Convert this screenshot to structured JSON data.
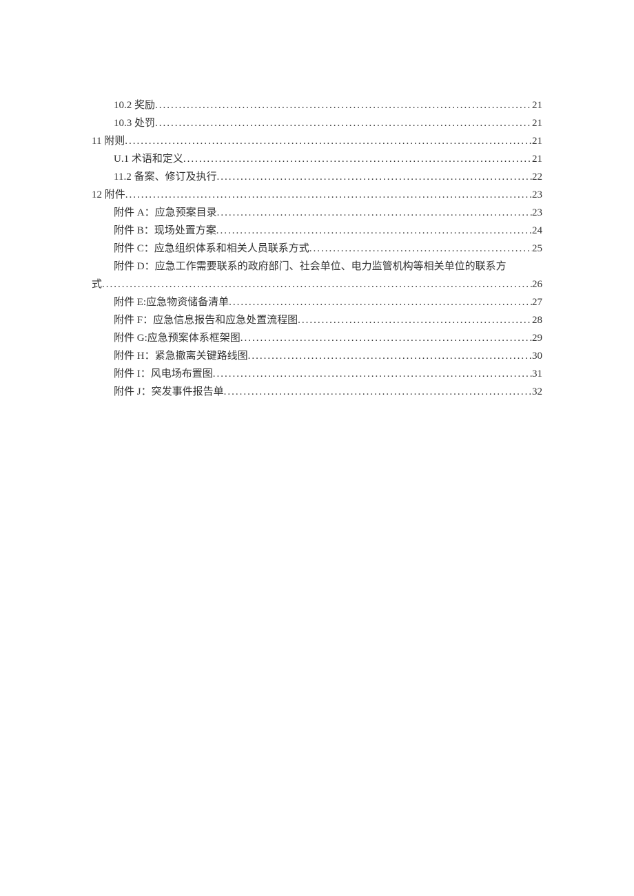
{
  "toc": {
    "items": [
      {
        "label": "10.2 奖励",
        "page": "21",
        "indent": 1
      },
      {
        "label": "10.3 处罚",
        "page": "21",
        "indent": 1
      },
      {
        "label": "11 附则",
        "page": "21",
        "indent": 0
      },
      {
        "label": "U.1 术语和定义",
        "page": "21",
        "indent": 1
      },
      {
        "label": "11.2 备案、修订及执行",
        "page": "22",
        "indent": 1
      },
      {
        "label": "12 附件",
        "page": "23",
        "indent": 0
      },
      {
        "label": "附件 A：应急预案目录",
        "page": "23",
        "indent": 1
      },
      {
        "label": "附件 B：现场处置方案",
        "page": "24",
        "indent": 1
      },
      {
        "label": "附件 C：应急组织体系和相关人员联系方式",
        "page": "25",
        "indent": 1
      }
    ],
    "wrap": {
      "line1": "附件 D：应急工作需要联系的政府部门、社会单位、电力监管机构等相关单位的联系方",
      "line2_label": "式 ",
      "page": "26"
    },
    "items2": [
      {
        "label": "附件 E:应急物资储备清单",
        "page": "27",
        "indent": 1
      },
      {
        "label": "附件 F：应急信息报告和应急处置流程图",
        "page": "28",
        "indent": 1
      },
      {
        "label": "附件 G:应急预案体系框架图",
        "page": "29",
        "indent": 1
      },
      {
        "label": "附件 H：紧急撤离关键路线图",
        "page": "30",
        "indent": 1
      },
      {
        "label": "附件 I：风电场布置图",
        "page": "31",
        "indent": 1
      },
      {
        "label": "附件 J：突发事件报告单",
        "page": "32",
        "indent": 1
      }
    ]
  }
}
